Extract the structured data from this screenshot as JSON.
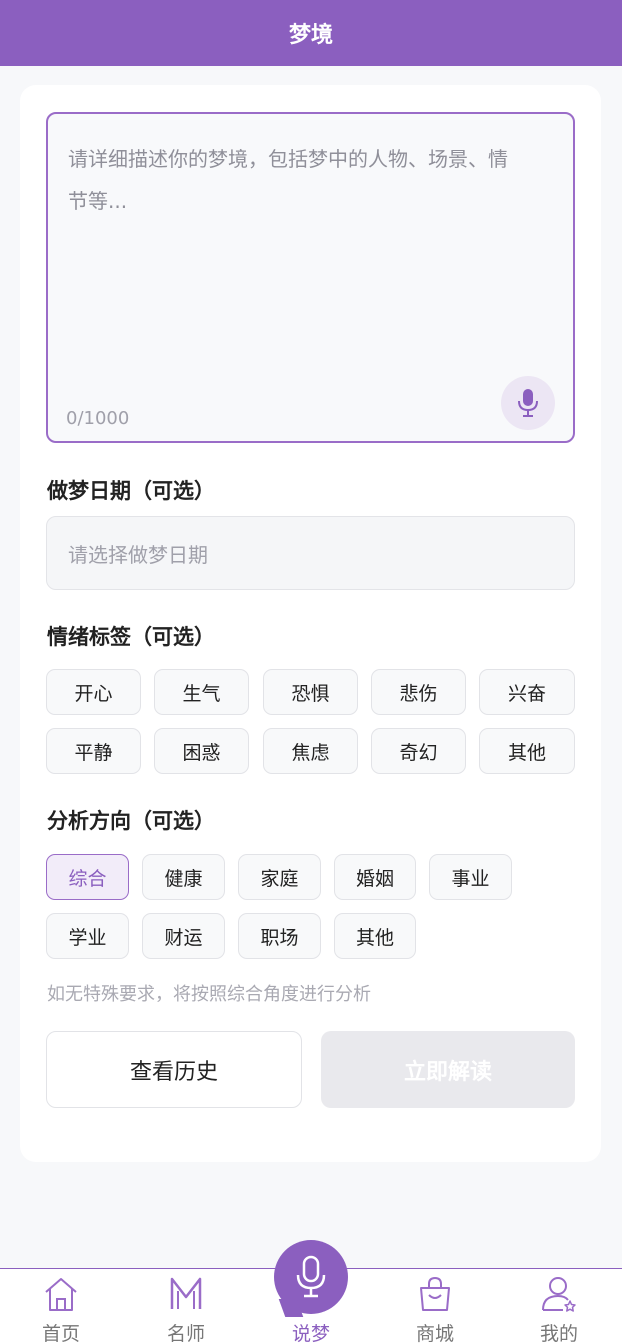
{
  "header": {
    "title": "梦境"
  },
  "dream_input": {
    "placeholder": "请详细描述你的梦境，包括梦中的人物、场景、情节等...",
    "char_count": "0/1000"
  },
  "date_section": {
    "title": "做梦日期（可选）",
    "placeholder": "请选择做梦日期"
  },
  "emotion_section": {
    "title": "情绪标签（可选）",
    "tags": [
      "开心",
      "生气",
      "恐惧",
      "悲伤",
      "兴奋",
      "平静",
      "困惑",
      "焦虑",
      "奇幻",
      "其他"
    ]
  },
  "analysis_section": {
    "title": "分析方向（可选）",
    "tags": [
      "综合",
      "健康",
      "家庭",
      "婚姻",
      "事业",
      "学业",
      "财运",
      "职场",
      "其他"
    ],
    "selected": "综合",
    "hint": "如无特殊要求，将按照综合角度进行分析"
  },
  "buttons": {
    "history": "查看历史",
    "interpret": "立即解读"
  },
  "tabbar": {
    "items": [
      {
        "label": "首页",
        "icon": "home-icon"
      },
      {
        "label": "名师",
        "icon": "master-m-icon"
      },
      {
        "label": "说梦",
        "icon": "microphone-icon",
        "active": true
      },
      {
        "label": "商城",
        "icon": "shopping-bag-icon"
      },
      {
        "label": "我的",
        "icon": "profile-icon"
      }
    ]
  },
  "colors": {
    "primary": "#8b5fbf",
    "background": "#f7f8fa",
    "disabled_button": "#e9e9ed"
  }
}
